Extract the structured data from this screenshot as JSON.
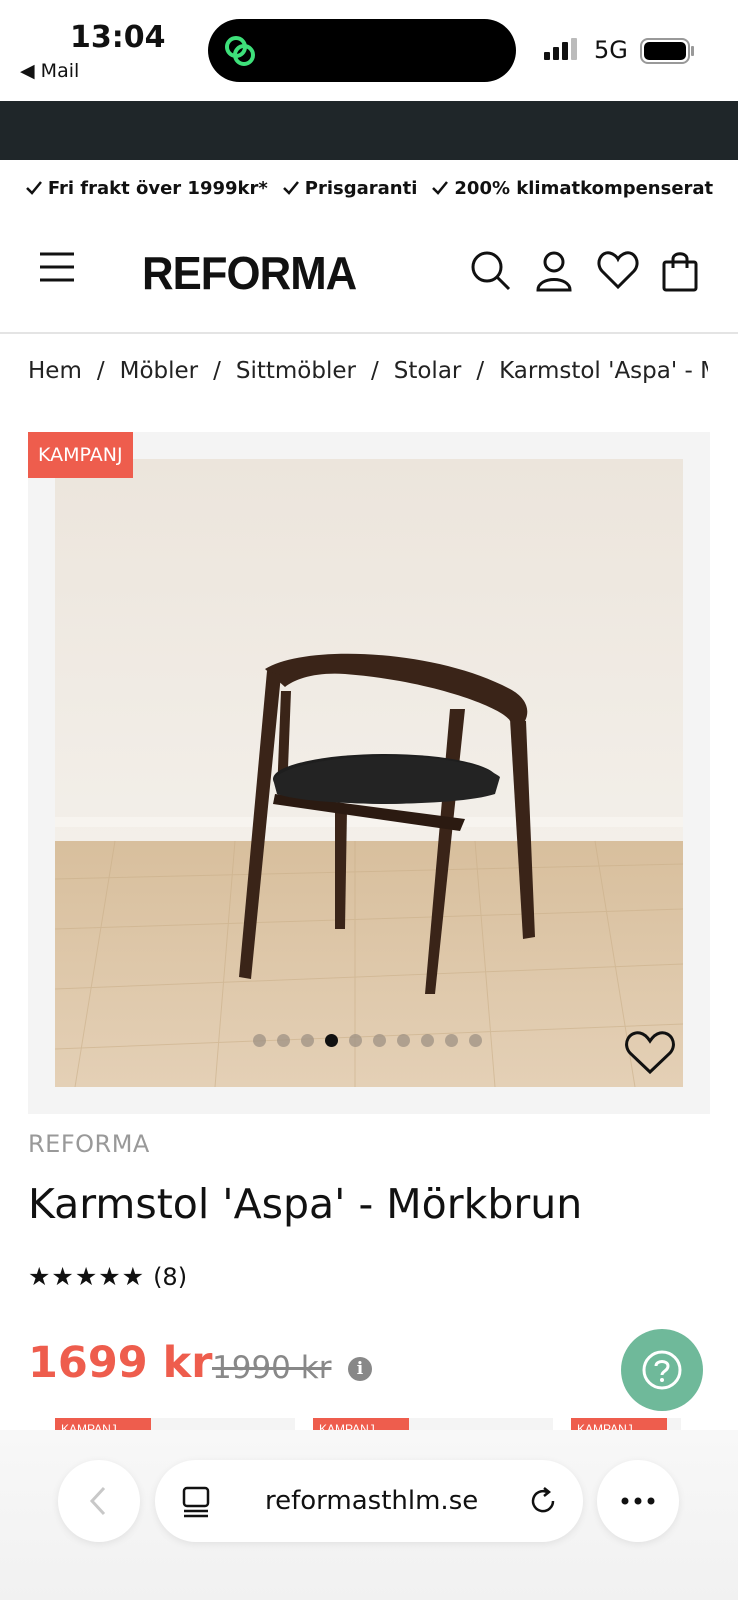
{
  "status_bar": {
    "time": "13:04",
    "back_app": "Mail",
    "network": "5G"
  },
  "usp": [
    "Fri frakt över 1999kr*",
    "Prisgaranti",
    "200% klimatkompenserat"
  ],
  "header": {
    "logo": "REFORMA",
    "icons": [
      "menu-icon",
      "search-icon",
      "account-icon",
      "heart-icon",
      "bag-icon"
    ]
  },
  "breadcrumb": [
    "Hem",
    "Möbler",
    "Sittmöbler",
    "Stolar",
    "Karmstol 'Aspa' - Mörkbrun"
  ],
  "gallery": {
    "badge": "KAMPANJ",
    "dot_count": 10,
    "active_dot": 3
  },
  "product": {
    "brand": "REFORMA",
    "title": "Karmstol 'Aspa' - Mörkbrun",
    "stars": "★★★★★",
    "review_count": "(8)",
    "price": "1699 kr",
    "old_price": "1990 kr"
  },
  "related_badge": "KAMPANJ",
  "browser": {
    "url": "reformasthlm.se"
  },
  "colors": {
    "accent": "#ee5d4d",
    "dark_band": "#1f2629",
    "help": "#6fb99a"
  }
}
